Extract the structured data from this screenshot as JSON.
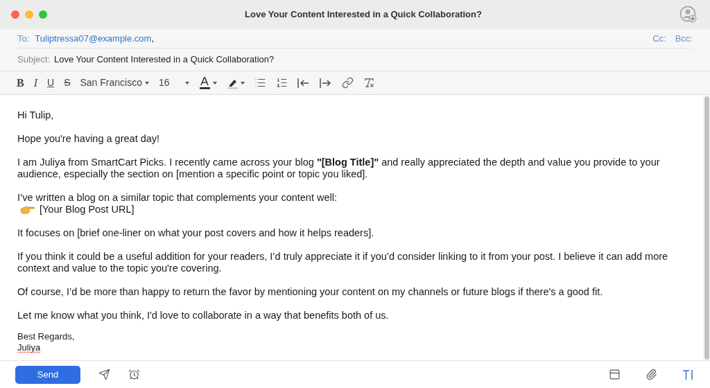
{
  "window": {
    "title": "Love Your Content Interested in a Quick Collaboration?"
  },
  "header": {
    "to_label": "To:",
    "to_address": "Tuliptressa07@example.com",
    "to_separator": ",",
    "cc": "Cc:",
    "bcc": "Bcc:",
    "subject_label": "Subject:",
    "subject": "Love Your Content Interested in a Quick Collaboration?"
  },
  "toolbar": {
    "bold": "B",
    "italic": "I",
    "underline": "U",
    "strikethrough": "S",
    "font": "San Francisco",
    "size": "16"
  },
  "body": [
    {
      "kind": "text",
      "text": "Hi Tulip,"
    },
    {
      "kind": "text",
      "text": "Hope you're having a great day!"
    },
    {
      "kind": "text",
      "text": "I am Juliya from SmartCart Picks. I recently came across your blog **\"[Blog Title]\"** and really appreciated the depth and value you provide to your audience, especially the section on [mention a specific point or topic you liked]."
    },
    {
      "kind": "link",
      "text": "I’ve written a blog on a similar topic that complements your content well:",
      "link": "[Your Blog Post URL]"
    },
    {
      "kind": "text",
      "text": " It focuses on [brief one-liner on what your post covers and how it helps readers]."
    },
    {
      "kind": "text",
      "text": "If you think it could be a useful addition for your readers, I’d truly appreciate it if you’d consider linking to it from your post. I believe it can add more context and value to the topic you're covering."
    },
    {
      "kind": "text",
      "text": "Of course, I’d be more than happy to return the favor by mentioning your content on my channels or future blogs if there's a good fit."
    },
    {
      "kind": "text",
      "text": "Let me know what you think, I'd love to collaborate in a way that benefits both of us."
    }
  ],
  "signature": [
    {
      "text": "Best Regards,",
      "misspelled": false
    },
    {
      "text": "Juliya",
      "misspelled": true
    }
  ],
  "footer": {
    "send": "Send"
  }
}
